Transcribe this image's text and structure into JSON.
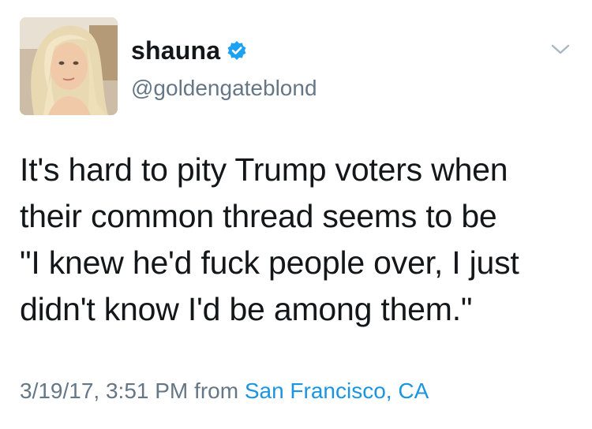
{
  "tweet": {
    "author": {
      "display_name": "shauna",
      "handle": "@goldengateblond",
      "verified": true,
      "avatar_icon": "user-avatar-photo"
    },
    "text": "It's hard to pity Trump voters when\ntheir common thread seems to be\n\"I knew he'd fuck people over, I just\ndidn't know I'd be among them.\"",
    "timestamp": "3/19/17, 3:51 PM",
    "source_prefix": "from",
    "location": "San Francisco, CA",
    "menu_icon": "chevron-down-icon"
  },
  "colors": {
    "text": "#14171a",
    "secondary": "#657786",
    "link": "#1b95e0",
    "verified_badge": "#1da1f2",
    "chevron": "#aab8c2"
  }
}
